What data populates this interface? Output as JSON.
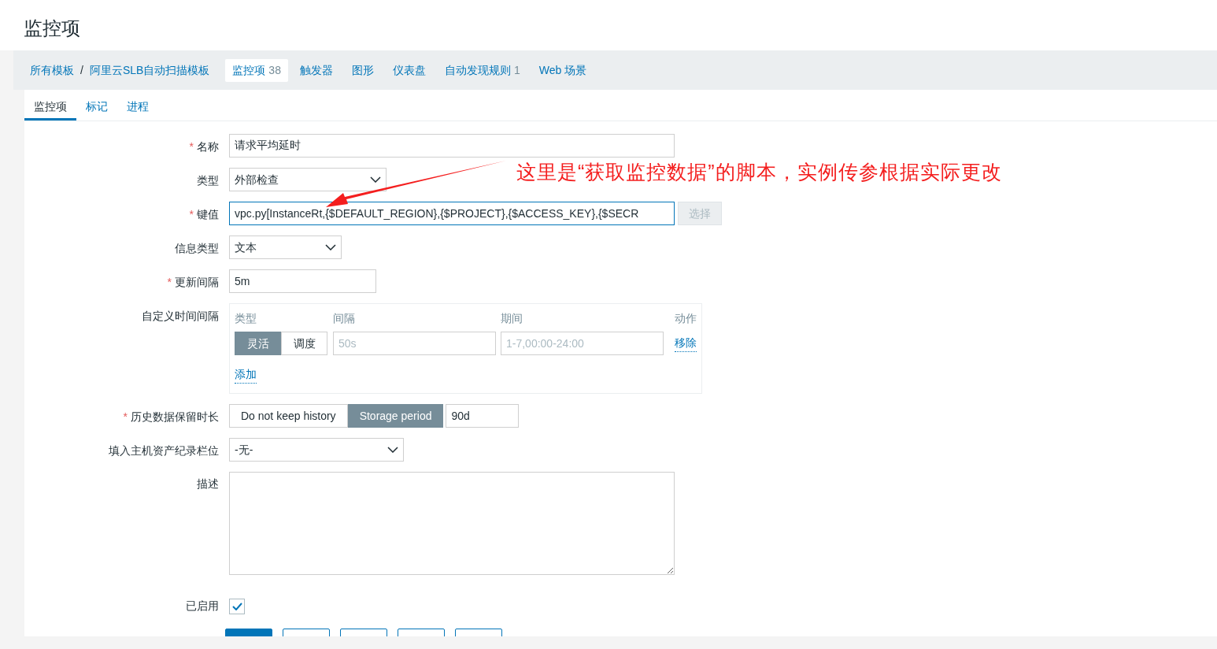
{
  "page_title": "监控项",
  "breadcrumbs": [
    {
      "label": "所有模板"
    },
    {
      "label": "阿里云SLB自动扫描模板"
    }
  ],
  "breadcrumb_separator": "/",
  "nav_tabs": [
    {
      "label": "监控项",
      "count": "38",
      "selected": true
    },
    {
      "label": "触发器",
      "selected": false
    },
    {
      "label": "图形",
      "selected": false
    },
    {
      "label": "仪表盘",
      "selected": false
    },
    {
      "label": "自动发现规则",
      "count": "1",
      "selected": false
    },
    {
      "label": "Web 场景",
      "selected": false
    }
  ],
  "form_tabs": [
    {
      "label": "监控项",
      "selected": true
    },
    {
      "label": "标记",
      "selected": false
    },
    {
      "label": "进程",
      "selected": false
    }
  ],
  "name": {
    "label": "名称",
    "required": true,
    "value": "请求平均延时"
  },
  "required_mark": "*",
  "type": {
    "label": "类型",
    "value": "外部检查"
  },
  "key": {
    "label": "键值",
    "required": true,
    "value": "vpc.py[InstanceRt,{$DEFAULT_REGION},{$PROJECT},{$ACCESS_KEY},{$SECR",
    "button": "选择",
    "button_disabled": true
  },
  "info_type": {
    "label": "信息类型",
    "value": "文本"
  },
  "update_interval": {
    "label": "更新间隔",
    "required": true,
    "value": "5m"
  },
  "custom_intervals": {
    "label": "自定义时间间隔",
    "headers": [
      "类型",
      "间隔",
      "期间",
      "动作"
    ],
    "rows": [
      {
        "modes": [
          {
            "label": "灵活",
            "selected": true
          },
          {
            "label": "调度",
            "selected": false
          }
        ],
        "interval_placeholder": "50s",
        "period_placeholder": "1-7,00:00-24:00",
        "action": "移除"
      }
    ],
    "add": "添加"
  },
  "history": {
    "label": "历史数据保留时长",
    "required": true,
    "options": [
      {
        "label": "Do not keep history",
        "selected": false
      },
      {
        "label": "Storage period",
        "selected": true
      }
    ],
    "value": "90d"
  },
  "inventory": {
    "label": "填入主机资产纪录栏位",
    "value": "-无-"
  },
  "description": {
    "label": "描述"
  },
  "enabled": {
    "label": "已启用",
    "checked": true
  },
  "buttons": [
    {
      "kind": "primary"
    },
    {
      "kind": "secondary"
    },
    {
      "kind": "secondary"
    },
    {
      "kind": "secondary"
    },
    {
      "kind": "secondary"
    }
  ],
  "annotation": {
    "text": "这里是“获取监控数据”的脚本，实例传参根据实际更改"
  }
}
